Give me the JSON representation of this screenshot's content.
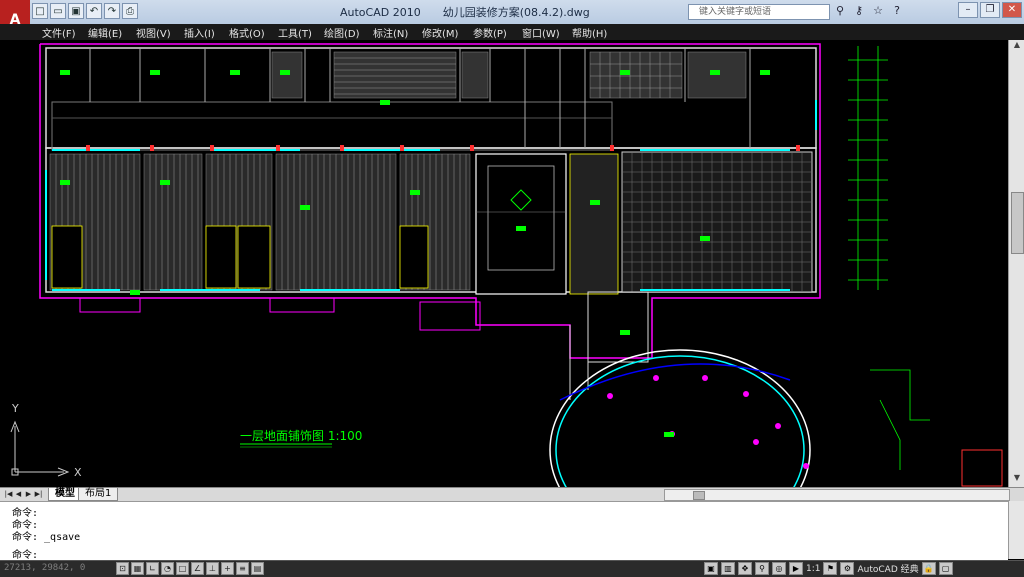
{
  "titlebar": {
    "app_name": "AutoCAD 2010",
    "file_name": "幼儿园装修方案(08.4.2).dwg",
    "search_placeholder": "键入关键字或短语",
    "qat_icons": [
      "new-icon",
      "open-icon",
      "save-icon",
      "undo-icon",
      "redo-icon",
      "plot-icon"
    ]
  },
  "menubar": {
    "items": [
      "文件(F)",
      "编辑(E)",
      "视图(V)",
      "插入(I)",
      "格式(O)",
      "工具(T)",
      "绘图(D)",
      "标注(N)",
      "修改(M)",
      "参数(P)",
      "窗口(W)",
      "帮助(H)"
    ]
  },
  "drawing": {
    "title": "一层地面铺饰图 1:100",
    "ucs_y": "Y",
    "ucs_x": "X",
    "background": "#000000",
    "colors": {
      "wall": "#ffffff",
      "room_label": "#00ff00",
      "outline": "#ff00ff",
      "window": "#00ffff",
      "dimension": "#00ff00",
      "red": "#ff3030",
      "yellow": "#ffff00"
    }
  },
  "tabs": {
    "model": "模型",
    "layout1": "布局1"
  },
  "command": {
    "lines": [
      "命令:",
      "命令:",
      "命令: _qsave"
    ],
    "prompt": "命令:"
  },
  "status": {
    "coordinates": "27213, 29842, 0",
    "annotation_scale": "1:1",
    "workspace": "AutoCAD 经典"
  }
}
